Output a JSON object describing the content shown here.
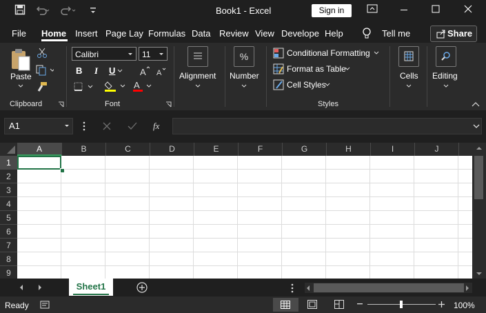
{
  "window": {
    "title": "Book1  -  Excel",
    "sign_in": "Sign in"
  },
  "quick_access": {
    "undo_icon": "undo-icon",
    "redo_icon": "redo-icon"
  },
  "menu": {
    "tabs": [
      "File",
      "Home",
      "Insert",
      "Page Lay",
      "Formulas",
      "Data",
      "Review",
      "View",
      "Develope",
      "Help"
    ],
    "active_tab": "Home",
    "tell_me": "Tell me",
    "share": "Share"
  },
  "ribbon": {
    "clipboard": {
      "paste": "Paste",
      "label": "Clipboard"
    },
    "font": {
      "name": "Calibri",
      "size": "11",
      "bold": "B",
      "italic": "I",
      "underline": "U",
      "label": "Font",
      "highlight_color": "#ffff00",
      "font_color": "#ff0000"
    },
    "alignment": {
      "label": "Alignment"
    },
    "number": {
      "label": "Number",
      "icon_text": "%"
    },
    "styles": {
      "conditional": "Conditional Formatting",
      "format_table": "Format as Table",
      "cell_styles": "Cell Styles",
      "label": "Styles"
    },
    "cells": {
      "label": "Cells"
    },
    "editing": {
      "label": "Editing"
    }
  },
  "formula_bar": {
    "name_box": "A1",
    "fx": "fx",
    "value": ""
  },
  "grid": {
    "columns": [
      "A",
      "B",
      "C",
      "D",
      "E",
      "F",
      "G",
      "H",
      "I",
      "J"
    ],
    "rows": [
      "1",
      "2",
      "3",
      "4",
      "5",
      "6",
      "7",
      "8",
      "9"
    ],
    "active_cell": "A1"
  },
  "sheets": {
    "tabs": [
      "Sheet1"
    ],
    "active": "Sheet1"
  },
  "status": {
    "ready": "Ready",
    "zoom": "100%"
  },
  "colors": {
    "accent": "#217346",
    "background": "#1f1f1f",
    "ribbon": "#2b2b2b"
  }
}
